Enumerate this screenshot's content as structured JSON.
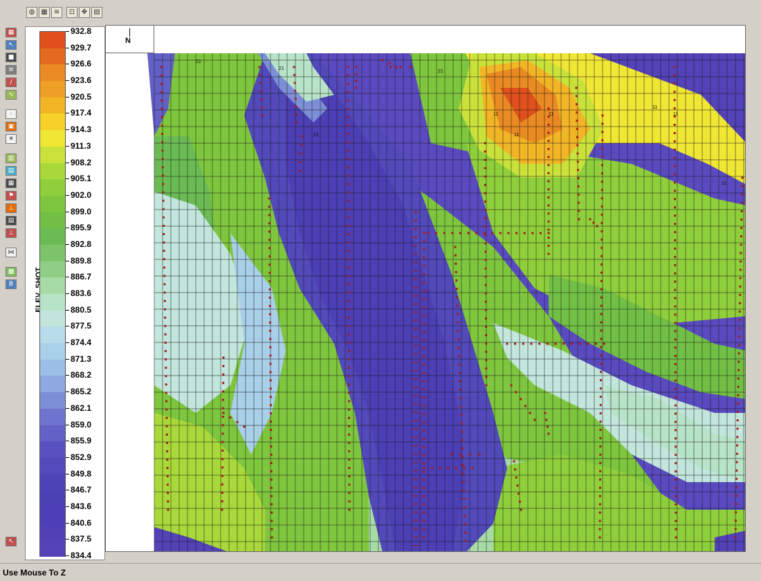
{
  "toolbar": {
    "icons": [
      "globe-icon",
      "grid-icon",
      "layers-icon",
      "zoom-extent-icon",
      "pan-icon",
      "map-icon"
    ]
  },
  "left_tools": {
    "icons": [
      "color-map-icon",
      "select-icon",
      "fill-icon",
      "contour-icon",
      "pen-icon",
      "chart-icon",
      "marker-icon",
      "palette-icon",
      "sun-icon",
      "layer-add-icon",
      "layer-icon",
      "grid-icon",
      "flag-icon",
      "ruler-icon",
      "table-icon",
      "measure-icon",
      "swatch-icon",
      "bold-b-icon",
      "pointer-icon",
      "palette-small-icon"
    ]
  },
  "legend": {
    "title": "ELEV_SHOT",
    "values": [
      "932.8",
      "929.7",
      "926.6",
      "923.6",
      "920.5",
      "917.4",
      "914.3",
      "911.3",
      "908.2",
      "905.1",
      "902.0",
      "899.0",
      "895.9",
      "892.8",
      "889.8",
      "886.7",
      "883.6",
      "880.5",
      "877.5",
      "874.4",
      "871.3",
      "868.2",
      "865.2",
      "862.1",
      "859.0",
      "855.9",
      "852.9",
      "849.8",
      "846.7",
      "843.6",
      "840.6",
      "837.5",
      "834.4"
    ],
    "colors": [
      "#e0501c",
      "#e46a1e",
      "#e98a22",
      "#ee9f26",
      "#f2b526",
      "#f5d12a",
      "#f0e634",
      "#c9e23a",
      "#a9d83a",
      "#8fcf3c",
      "#7ec63e",
      "#72bf45",
      "#6bbb55",
      "#7cc36a",
      "#8fce84",
      "#a6dba6",
      "#b7e3c8",
      "#c2e6dc",
      "#b7ddea",
      "#a9d0e9",
      "#9bbfe6",
      "#8da9df",
      "#7d8fd6",
      "#6e74ce",
      "#6360c6",
      "#5951c0",
      "#5249bb",
      "#4d43b7",
      "#4c40b5",
      "#4d3fb5",
      "#5040b6",
      "#5442b8"
    ]
  },
  "map": {
    "north_label": "N",
    "line_labels": [
      "21",
      "21",
      "21",
      "21",
      "11",
      "11",
      "11",
      "11",
      "11",
      "11"
    ]
  },
  "status": {
    "text": "Use Mouse To Z"
  }
}
